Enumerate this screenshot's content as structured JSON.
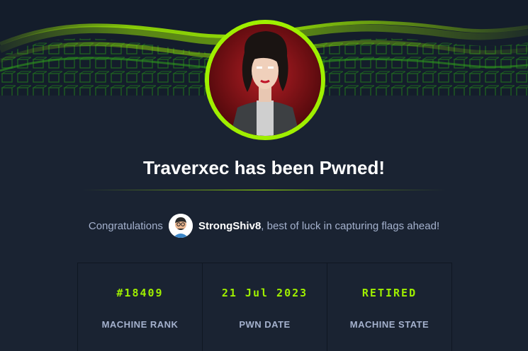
{
  "header": {
    "title": "Traverxec has been Pwned!"
  },
  "congrats": {
    "lead": "Congratulations",
    "username": "StrongShiv8",
    "message": ", best of luck in capturing flags ahead!"
  },
  "stats": [
    {
      "value": "#18409",
      "label": "MACHINE RANK"
    },
    {
      "value": "21 Jul 2023",
      "label": "PWN DATE"
    },
    {
      "value": "RETIRED",
      "label": "MACHINE STATE"
    }
  ],
  "colors": {
    "accent": "#9fef00",
    "background": "#1a2332",
    "muted_text": "#a4b1cd"
  },
  "icons": {
    "machine_avatar": "machine-avatar-image",
    "user_avatar": "user-avatar-image"
  }
}
